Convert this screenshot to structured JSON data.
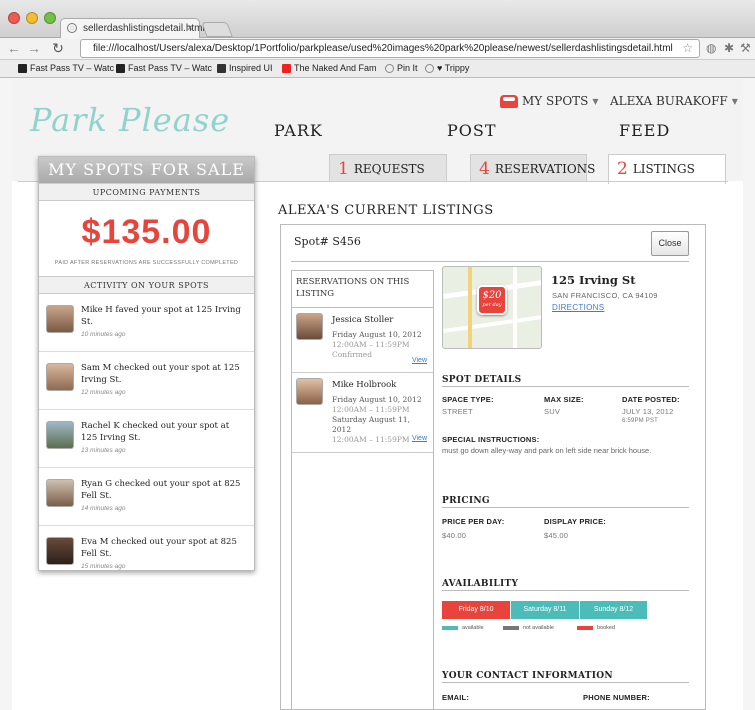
{
  "browser": {
    "tab_title": "sellerdashlistingsdetail.html",
    "tab_close": "×",
    "url": "file:///localhost/Users/alexa/Desktop/1Portfolio/parkplease/used%20images%20park%20please/newest/sellerdashlistingsdetail.html",
    "bookmarks": [
      "Fast Pass TV – Watc",
      "Fast Pass TV – Watc",
      "Inspired UI",
      "The Naked And Fam",
      "Pin It",
      "♥ Trippy"
    ]
  },
  "colors": {
    "brand": "#8fd3cc",
    "accent": "#e8443c",
    "teal": "#4bbcb7",
    "grey": "#777777",
    "link": "#3a7bd5"
  },
  "header": {
    "logo": "Park Please",
    "my_spots": "MY SPOTS",
    "user": "ALEXA BURAKOFF",
    "nav": [
      "PARK",
      "POST",
      "FEED"
    ]
  },
  "subtabs": [
    {
      "num": "1",
      "label": "REQUESTS"
    },
    {
      "num": "4",
      "label": "RESERVATIONS"
    },
    {
      "num": "2",
      "label": "LISTINGS"
    }
  ],
  "sidebar": {
    "title": "MY SPOTS FOR SALE",
    "upcoming_label": "UPCOMING PAYMENTS",
    "amount": "$135.00",
    "paid_note": "PAID AFTER RESERVATIONS ARE SUCCESSFULLY COMPLETED",
    "activity_label": "ACTIVITY ON YOUR SPOTS",
    "activity": [
      {
        "text": "Mike H faved your spot at 125 Irving St.",
        "time": "10 minutes ago"
      },
      {
        "text": "Sam M checked out your spot at 125 Irving St.",
        "time": "12 minutes ago"
      },
      {
        "text": "Rachel K checked out your spot at 125 Irving St.",
        "time": "13 minutes ago"
      },
      {
        "text": "Ryan G checked out your spot at 825 Fell St.",
        "time": "14 minutes ago"
      },
      {
        "text": "Eva M checked out your spot at 825 Fell St.",
        "time": "15 minutes ago"
      }
    ]
  },
  "listing": {
    "page_title": "ALEXA'S CURRENT LISTINGS",
    "spot": "Spot# S456",
    "close": "Close",
    "reservations_head": "RESERVATIONS ON THIS LISTING",
    "reservations": [
      {
        "name": "Jessica Stoller",
        "date1": "Friday August 10, 2012",
        "time1": "12:00AM – 11:59PM",
        "status": "Confirmed",
        "view": "View"
      },
      {
        "name": "Mike Holbrook",
        "date1": "Friday August 10, 2012",
        "time1": "12:00AM – 11:59PM",
        "date2": "Saturday August 11, 2012",
        "time2": "12:00AM – 11:59PM",
        "view": "View"
      }
    ],
    "map_price": "$20",
    "map_price_sub": "per day",
    "address": "125 Irving St",
    "city": "SAN FRANCISCO, CA 94109",
    "directions": "DIRECTIONS",
    "details_title": "SPOT DETAILS",
    "space_type_label": "SPACE TYPE:",
    "space_type": "STREET",
    "max_size_label": "MAX SIZE:",
    "max_size": "SUV",
    "date_posted_label": "DATE POSTED:",
    "date_posted": "JULY 13, 2012",
    "time_posted": "6:59PM PST",
    "instructions_label": "SPECIAL INSTRUCTIONS:",
    "instructions": "must go down alley-way and park on left side near brick house.",
    "pricing_title": "PRICING",
    "price_per_day_label": "PRICE PER DAY:",
    "price_per_day": "$40.00",
    "display_price_label": "DISPLAY PRICE:",
    "display_price": "$45.00",
    "availability_title": "AVAILABILITY",
    "availability": [
      {
        "day": "Friday 8/10",
        "status": "booked"
      },
      {
        "day": "Saturday 8/11",
        "status": "available"
      },
      {
        "day": "Sunday 8/12",
        "status": "available"
      }
    ],
    "legend": [
      "available",
      "not available",
      "booked"
    ],
    "contact_title": "YOUR CONTACT INFORMATION",
    "email_label": "EMAIL:",
    "phone_label": "PHONE NUMBER:"
  }
}
